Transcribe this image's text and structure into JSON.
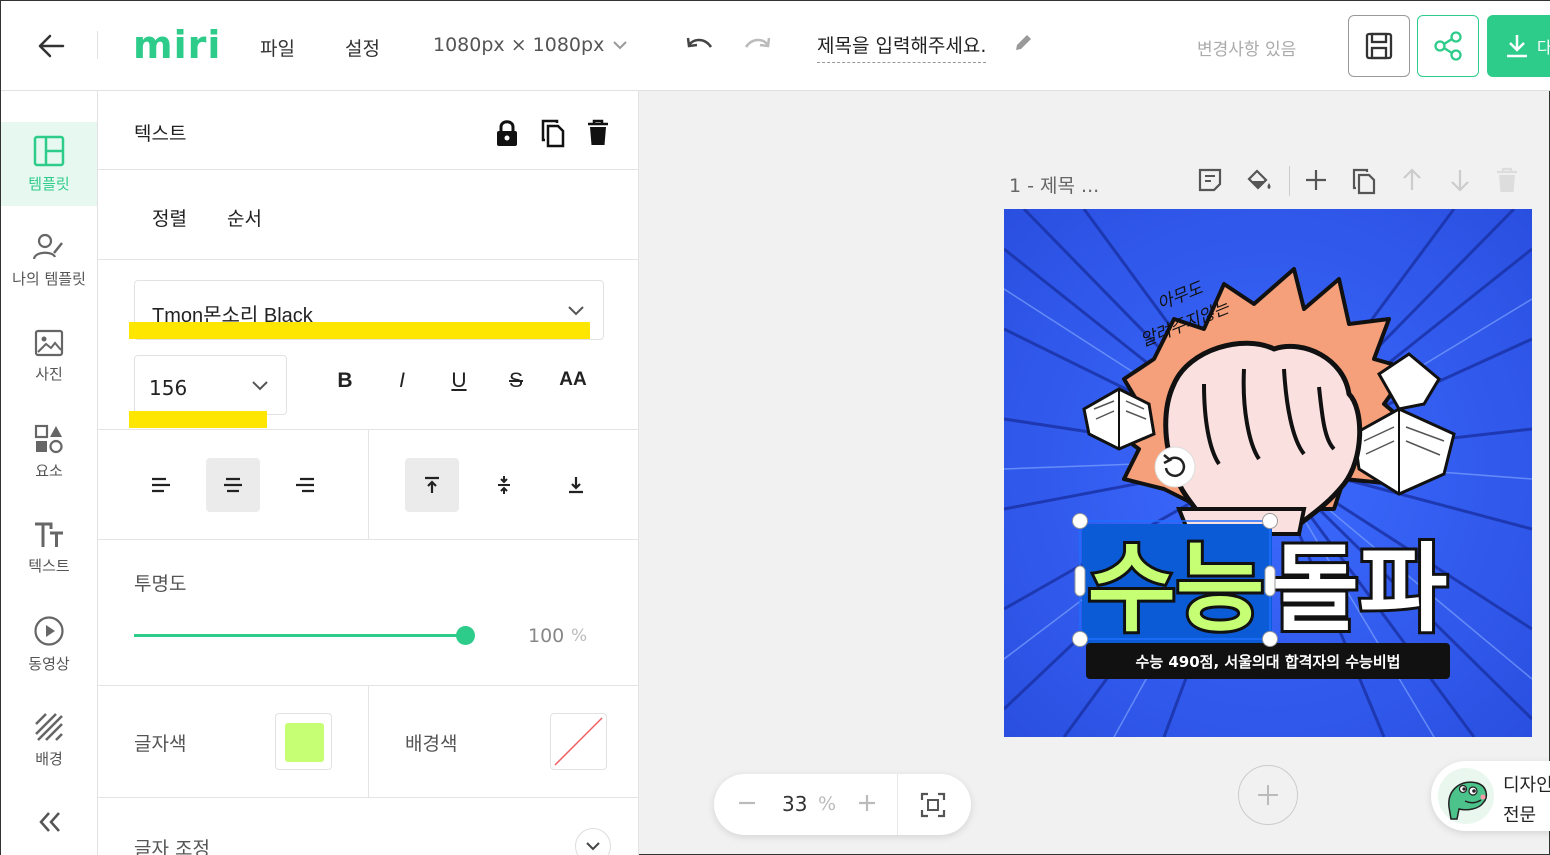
{
  "topbar": {
    "logo": "miri",
    "menu_file": "파일",
    "menu_settings": "설정",
    "canvas_size": "1080px × 1080px",
    "title": "제목을 입력해주세요.",
    "status": "변경사항 있음",
    "download_label": "다"
  },
  "leftnav": {
    "items": [
      {
        "label": "템플릿",
        "icon": "layout-icon",
        "active": true
      },
      {
        "label": "나의 템플릿",
        "icon": "user-edit-icon"
      },
      {
        "label": "사진",
        "icon": "image-icon"
      },
      {
        "label": "요소",
        "icon": "shapes-icon"
      },
      {
        "label": "텍스트",
        "icon": "text-icon"
      },
      {
        "label": "동영상",
        "icon": "play-icon"
      },
      {
        "label": "배경",
        "icon": "pattern-icon"
      }
    ]
  },
  "panel": {
    "title": "텍스트",
    "tab_align": "정렬",
    "tab_order": "순서",
    "font_family": "Tmon몬소리 Black",
    "font_size": "156",
    "style_buttons": [
      "B",
      "I",
      "U",
      "S",
      "AA"
    ],
    "opacity_label": "투명도",
    "opacity_value": "100",
    "opacity_unit": "%",
    "opacity_level": 1.0,
    "text_color_label": "글자색",
    "text_color": "#c6ff73",
    "bg_color_label": "배경색",
    "adjust_label": "글자 조정"
  },
  "canvas": {
    "page_label": "1 - 제목 ...",
    "zoom_value": "33",
    "zoom_unit": "%",
    "art": {
      "handwriting_1": "아무도",
      "handwriting_2": "알려주지않는",
      "headline_selected": "수능",
      "headline_rest": "돌파",
      "subtitle": "수능 490점, 서울의대 합격자의 수능비법"
    }
  },
  "helper": {
    "line1": "디자인",
    "line2": "전문"
  },
  "colors": {
    "accent": "#2ecc8a",
    "highlight": "#ffe600",
    "artboard_bg": "#2f5bf0"
  }
}
